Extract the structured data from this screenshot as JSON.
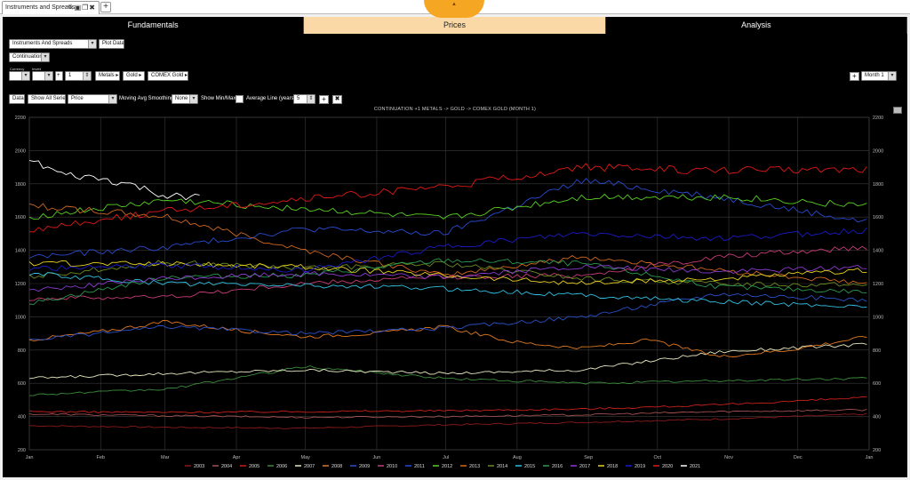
{
  "doc_tab": {
    "label": "Instruments and Spreads"
  },
  "nav": {
    "tabs": [
      {
        "label": "Fundamentals",
        "active": false
      },
      {
        "label": "Prices",
        "active": true
      },
      {
        "label": "Analysis",
        "active": false
      }
    ]
  },
  "controls": {
    "source_select": "Instruments And Spreads",
    "plot_data_label": "Plot Data",
    "roll_select": "Continuation",
    "currency_label": "Currency",
    "invert_label": "Invert",
    "operator": "+",
    "multiplier": "1",
    "sector": "Metals",
    "commodity": "Gold",
    "instrument": "COMEX Gold",
    "month_select": "Month 1",
    "data_button": "Data",
    "show_all_series": "Show All Series",
    "price_select": "Price",
    "moving_avg_label": "Moving Avg Smoothing",
    "moving_avg_select": "None",
    "show_minmax_label": "Show Min/Max",
    "average_line_label": "Average Line (years)",
    "average_years": "5"
  },
  "colors": {
    "accent_tab": "#fad9a6",
    "handle": "#f5a623",
    "background": "#000000"
  },
  "chart_data": {
    "type": "line",
    "title": "CONTINUATION +1 METALS -> GOLD -> COMEX GOLD (MONTH 1)",
    "x_tick_labels": [
      "Jan",
      "Feb",
      "Mar",
      "Apr",
      "May",
      "Jun",
      "Jul",
      "Aug",
      "Sep",
      "Oct",
      "Nov",
      "Dec",
      "Jan"
    ],
    "x_day_ticks": [
      0,
      31,
      59,
      90,
      120,
      151,
      181,
      212,
      243,
      273,
      304,
      334,
      365
    ],
    "y_ticks": [
      200,
      400,
      600,
      800,
      1000,
      1200,
      1400,
      1600,
      1800,
      2000,
      2200
    ],
    "ylim": [
      200,
      2200
    ],
    "grid": true,
    "legend_position": "bottom",
    "series": [
      {
        "name": "2003",
        "color": "#8b1a1a",
        "x": [
          0,
          60,
          120,
          180,
          240,
          300,
          364
        ],
        "y": [
          345,
          335,
          330,
          350,
          365,
          385,
          415
        ]
      },
      {
        "name": "2004",
        "color": "#a05050",
        "x": [
          0,
          60,
          120,
          180,
          240,
          300,
          364
        ],
        "y": [
          415,
          405,
          395,
          400,
          410,
          430,
          440
        ]
      },
      {
        "name": "2005",
        "color": "#c8201c",
        "x": [
          0,
          60,
          120,
          180,
          240,
          300,
          364
        ],
        "y": [
          430,
          425,
          430,
          435,
          445,
          470,
          515
        ]
      },
      {
        "name": "2006",
        "color": "#3a8a3a",
        "x": [
          0,
          60,
          120,
          180,
          240,
          300,
          364
        ],
        "y": [
          530,
          565,
          700,
          630,
          600,
          615,
          630
        ]
      },
      {
        "name": "2007",
        "color": "#e8e8c0",
        "x": [
          0,
          60,
          120,
          180,
          240,
          300,
          364
        ],
        "y": [
          630,
          660,
          680,
          660,
          680,
          790,
          835
        ]
      },
      {
        "name": "2008",
        "color": "#e07820",
        "x": [
          0,
          30,
          60,
          90,
          120,
          150,
          180,
          210,
          240,
          270,
          300,
          330,
          364
        ],
        "y": [
          860,
          910,
          970,
          920,
          880,
          900,
          940,
          850,
          810,
          860,
          760,
          800,
          880
        ]
      },
      {
        "name": "2009",
        "color": "#2a50c8",
        "x": [
          0,
          60,
          120,
          180,
          240,
          300,
          364
        ],
        "y": [
          860,
          940,
          900,
          930,
          1000,
          1140,
          1100
        ]
      },
      {
        "name": "2010",
        "color": "#c83c78",
        "x": [
          0,
          60,
          120,
          180,
          240,
          300,
          364
        ],
        "y": [
          1110,
          1120,
          1200,
          1240,
          1250,
          1360,
          1420
        ]
      },
      {
        "name": "2011",
        "color": "#2a4ad0",
        "x": [
          0,
          60,
          120,
          180,
          240,
          300,
          364
        ],
        "y": [
          1360,
          1420,
          1530,
          1500,
          1820,
          1720,
          1570
        ]
      },
      {
        "name": "2012",
        "color": "#58d020",
        "x": [
          0,
          60,
          120,
          180,
          240,
          300,
          364
        ],
        "y": [
          1600,
          1700,
          1650,
          1590,
          1720,
          1720,
          1670
        ]
      },
      {
        "name": "2013",
        "color": "#d06820",
        "x": [
          0,
          60,
          120,
          180,
          240,
          300,
          364
        ],
        "y": [
          1670,
          1600,
          1400,
          1250,
          1360,
          1280,
          1200
        ]
      },
      {
        "name": "2014",
        "color": "#6a8a20",
        "x": [
          0,
          60,
          120,
          180,
          240,
          300,
          364
        ],
        "y": [
          1240,
          1330,
          1290,
          1320,
          1230,
          1200,
          1190
        ]
      },
      {
        "name": "2015",
        "color": "#30c0e0",
        "x": [
          0,
          60,
          120,
          180,
          240,
          300,
          364
        ],
        "y": [
          1260,
          1200,
          1190,
          1170,
          1130,
          1090,
          1060
        ]
      },
      {
        "name": "2016",
        "color": "#2a9a50",
        "x": [
          0,
          60,
          120,
          180,
          240,
          300,
          364
        ],
        "y": [
          1080,
          1240,
          1250,
          1340,
          1320,
          1180,
          1150
        ]
      },
      {
        "name": "2017",
        "color": "#8a3ad0",
        "x": [
          0,
          60,
          120,
          180,
          240,
          300,
          364
        ],
        "y": [
          1160,
          1230,
          1260,
          1240,
          1300,
          1270,
          1300
        ]
      },
      {
        "name": "2018",
        "color": "#e8d020",
        "x": [
          0,
          60,
          120,
          180,
          240,
          300,
          364
        ],
        "y": [
          1320,
          1320,
          1300,
          1250,
          1200,
          1230,
          1280
        ]
      },
      {
        "name": "2019",
        "color": "#1a1ac8",
        "x": [
          0,
          60,
          120,
          180,
          240,
          300,
          364
        ],
        "y": [
          1290,
          1310,
          1280,
          1420,
          1500,
          1470,
          1520
        ]
      },
      {
        "name": "2020",
        "color": "#e01818",
        "x": [
          0,
          60,
          120,
          180,
          240,
          300,
          364
        ],
        "y": [
          1520,
          1640,
          1710,
          1780,
          1900,
          1880,
          1890
        ]
      },
      {
        "name": "2021",
        "color": "#ffffff",
        "x": [
          0,
          15,
          30,
          45,
          60,
          75
        ],
        "y": [
          1940,
          1850,
          1830,
          1790,
          1720,
          1730
        ]
      }
    ]
  }
}
